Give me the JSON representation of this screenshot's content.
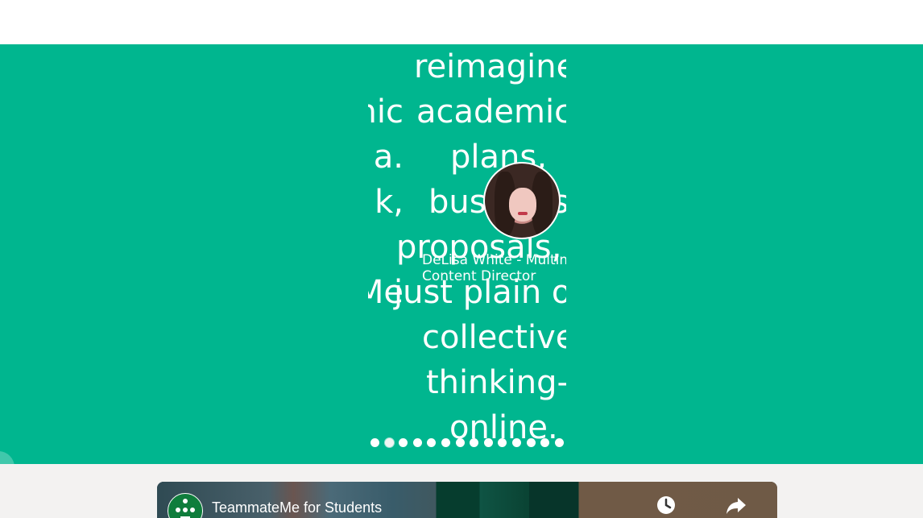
{
  "hero": {
    "background": "#00b68f",
    "prev_slide_lines": [
      "reimagined",
      "alk, academic",
      "a.",
      "k,",
      "",
      "Me"
    ],
    "current_slide_lines": [
      "reimagined",
      "academic",
      "plans,",
      "business",
      "proposals, or",
      "just plain old",
      "collective",
      "thinking-",
      "online."
    ],
    "author_lines": [
      "DeLisa White - Multim",
      "Content Director"
    ],
    "dot_count": 14,
    "active_dot": 1
  },
  "video": {
    "title": "TeammateMe for Students",
    "icons": [
      "channel-logo-icon",
      "watch-later-icon",
      "share-icon"
    ]
  }
}
